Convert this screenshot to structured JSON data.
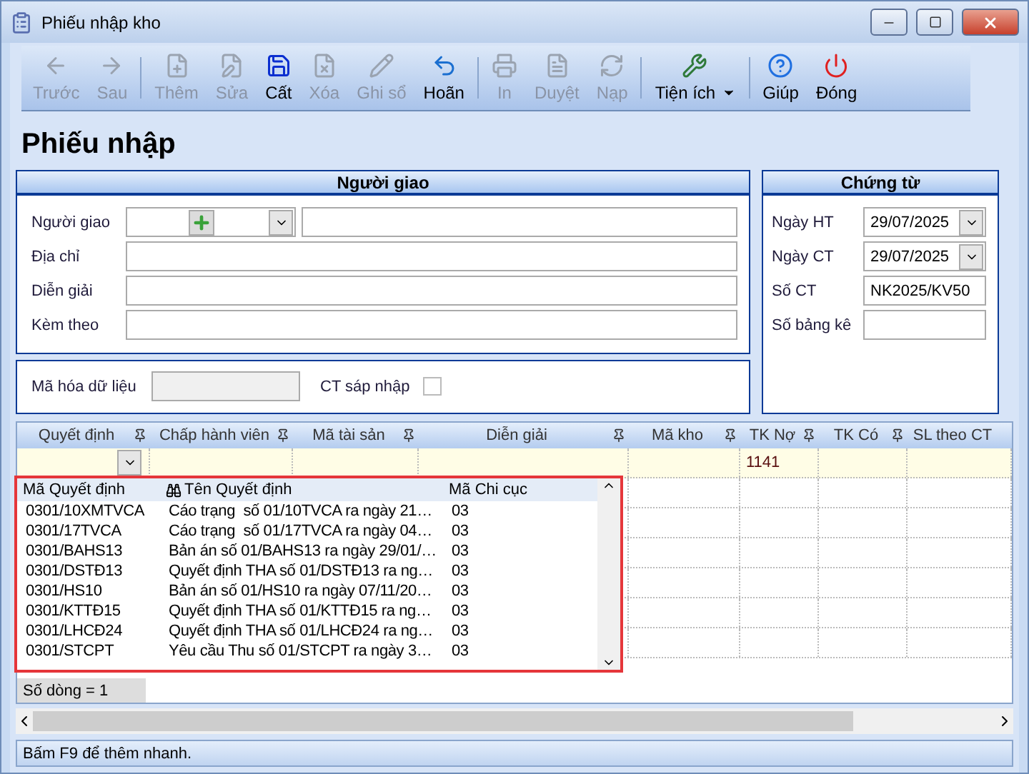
{
  "window": {
    "title": "Phiếu nhập kho"
  },
  "toolbar": [
    [
      {
        "label": "Trước",
        "disabled": true
      },
      {
        "label": "Sau",
        "disabled": true
      }
    ],
    [
      {
        "label": "Thêm",
        "disabled": true
      },
      {
        "label": "Sửa",
        "disabled": true
      },
      {
        "label": "Cất",
        "disabled": false
      },
      {
        "label": "Xóa",
        "disabled": true
      },
      {
        "label": "Ghi sổ",
        "disabled": true
      },
      {
        "label": "Hoãn",
        "disabled": false
      }
    ],
    [
      {
        "label": "In",
        "disabled": true
      },
      {
        "label": "Duyệt",
        "disabled": true
      },
      {
        "label": "Nạp",
        "disabled": true
      }
    ],
    [
      {
        "label": "Tiện ích",
        "disabled": false,
        "has_menu": true
      }
    ],
    [
      {
        "label": "Giúp",
        "disabled": false
      },
      {
        "label": "Đóng",
        "disabled": false
      }
    ]
  ],
  "page_title": "Phiếu nhập",
  "deliverer": {
    "title": "Người giao",
    "fields": [
      {
        "label": "Người giao",
        "kind": "lookup"
      },
      {
        "label": "Địa chỉ",
        "kind": "text"
      },
      {
        "label": "Diễn giải",
        "kind": "text"
      },
      {
        "label": "Kèm theo",
        "kind": "text"
      }
    ]
  },
  "extra": {
    "encode_label": "Mã hóa dữ liệu",
    "merge_label": "CT sáp nhập",
    "merge_checked": false
  },
  "voucher": {
    "title": "Chứng từ",
    "fields": [
      {
        "label": "Ngày HT",
        "value": "29/07/2025",
        "kind": "date"
      },
      {
        "label": "Ngày CT",
        "value": "29/07/2025",
        "kind": "date"
      },
      {
        "label": "Số CT",
        "value": "NK2025/KV50",
        "kind": "text"
      },
      {
        "label": "Số bảng kê",
        "kind": "text"
      }
    ]
  },
  "grid": {
    "columns": [
      "Quyết định",
      "Chấp hành viên",
      "Mã tài sản",
      "Diễn giải",
      "Mã kho",
      "TK Nợ",
      "TK Có",
      "SL theo CT"
    ],
    "rows": [
      {
        "cells": [
          "",
          "",
          "",
          "",
          "",
          "1141",
          "",
          ""
        ]
      }
    ],
    "row_count": "Số dòng = 1"
  },
  "dropdown": {
    "columns": [
      "Mã Quyết định",
      "Tên Quyết định",
      "Mã Chi cục"
    ],
    "rows": [
      {
        "code": "0301/10XMTVCA",
        "name": "Cáo trạng  số 01/10TVCA ra ngày 21…",
        "branch": "03",
        "selected": false
      },
      {
        "code": "0301/17TVCA",
        "name": "Cáo trạng  số 01/17TVCA ra ngày 04…",
        "branch": "03",
        "selected": false
      },
      {
        "code": "0301/BAHS13",
        "name": "Bản án số 01/BAHS13 ra ngày 29/01/…",
        "branch": "03",
        "selected": false
      },
      {
        "code": "0301/DSTĐ13",
        "name": "Quyết định THA số 01/DSTĐ13 ra ng…",
        "branch": "03",
        "selected": false
      },
      {
        "code": "0301/HS10",
        "name": "Bản án số 01/HS10 ra ngày 07/11/20…",
        "branch": "03",
        "selected": false
      },
      {
        "code": "0301/KTTĐ15",
        "name": "Quyết định THA số 01/KTTĐ15 ra ng…",
        "branch": "03",
        "selected": false
      },
      {
        "code": "0301/LHCĐ24",
        "name": "Quyết định THA số 01/LHCĐ24 ra ng…",
        "branch": "03",
        "selected": false
      },
      {
        "code": "0301/STCPT",
        "name": "Yêu cầu Thu số 01/STCPT ra ngày 3…",
        "branch": "03",
        "selected": false
      }
    ]
  },
  "status_bar": "Bấm F9 để thêm nhanh."
}
